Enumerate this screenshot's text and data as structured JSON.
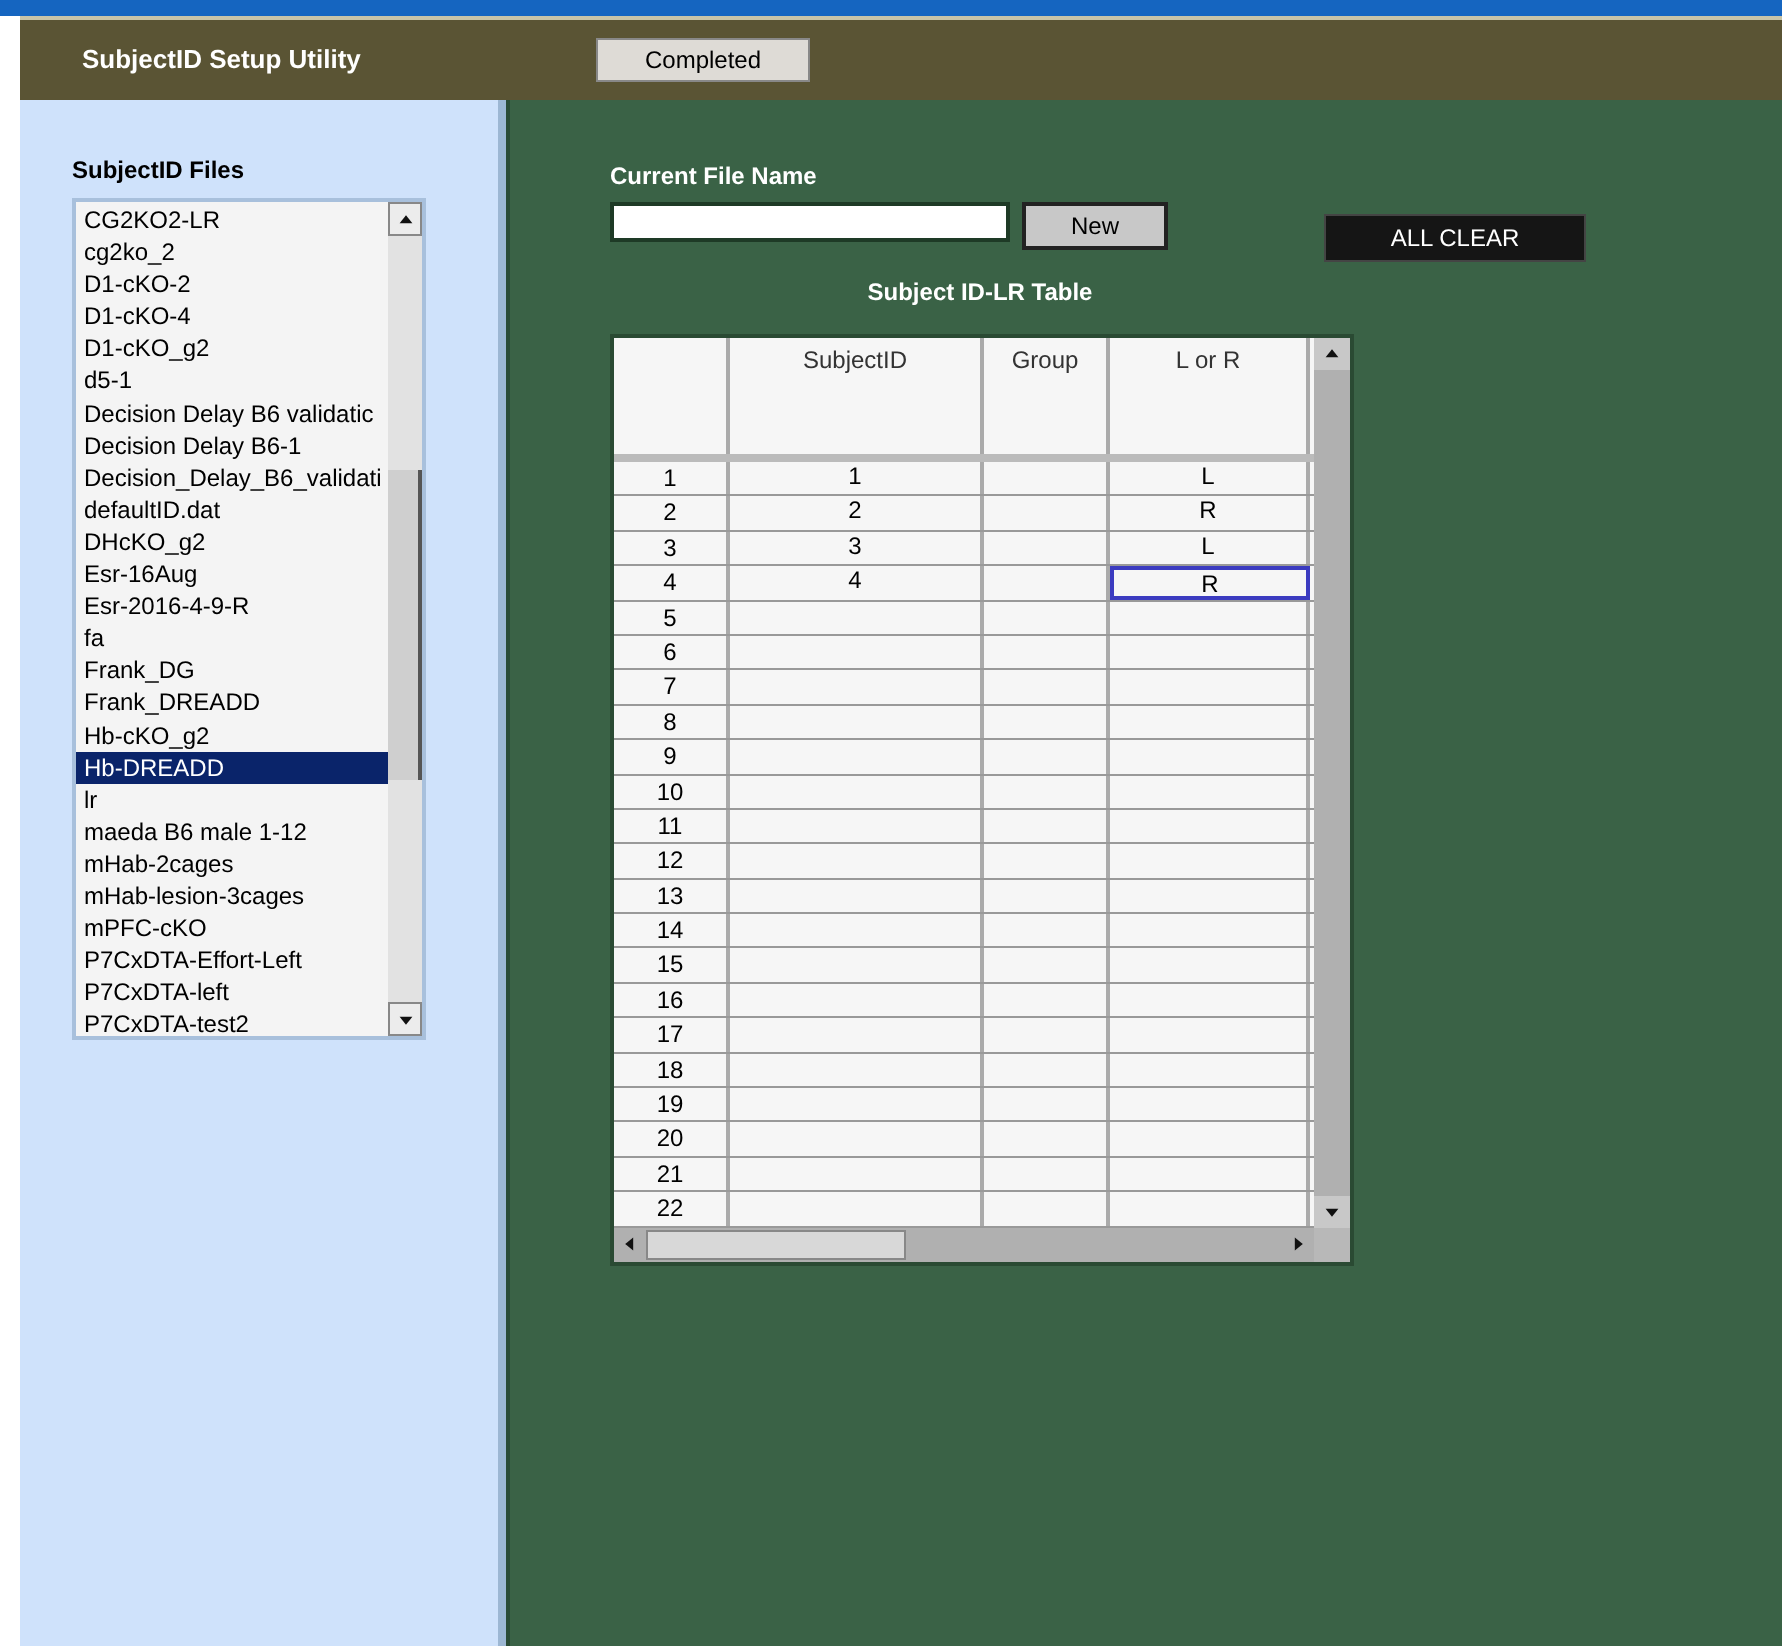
{
  "header": {
    "title": "SubjectID  Setup Utility",
    "button": "Completed"
  },
  "files": {
    "label": "SubjectID Files",
    "items": [
      {
        "name": "CG2KO2-LR",
        "selected": false
      },
      {
        "name": "cg2ko_2",
        "selected": false
      },
      {
        "name": "D1-cKO-2",
        "selected": false
      },
      {
        "name": "D1-cKO-4",
        "selected": false
      },
      {
        "name": "D1-cKO_g2",
        "selected": false
      },
      {
        "name": "d5-1",
        "selected": false
      },
      {
        "name": "Decision Delay B6 validatic",
        "selected": false
      },
      {
        "name": "Decision Delay B6-1",
        "selected": false
      },
      {
        "name": "Decision_Delay_B6_validati",
        "selected": false
      },
      {
        "name": "defaultID.dat",
        "selected": false
      },
      {
        "name": "DHcKO_g2",
        "selected": false
      },
      {
        "name": "Esr-16Aug",
        "selected": false
      },
      {
        "name": "Esr-2016-4-9-R",
        "selected": false
      },
      {
        "name": "fa",
        "selected": false
      },
      {
        "name": "Frank_DG",
        "selected": false
      },
      {
        "name": "Frank_DREADD",
        "selected": false
      },
      {
        "name": "Hb-cKO_g2",
        "selected": false
      },
      {
        "name": "Hb-DREADD",
        "selected": true
      },
      {
        "name": "lr",
        "selected": false
      },
      {
        "name": "maeda B6 male 1-12",
        "selected": false
      },
      {
        "name": "mHab-2cages",
        "selected": false
      },
      {
        "name": "mHab-lesion-3cages",
        "selected": false
      },
      {
        "name": "mPFC-cKO",
        "selected": false
      },
      {
        "name": "P7CxDTA-Effort-Left",
        "selected": false
      },
      {
        "name": "P7CxDTA-left",
        "selected": false
      },
      {
        "name": "P7CxDTA-test2",
        "selected": false
      }
    ]
  },
  "current_file": {
    "label": "Current File Name",
    "new_button": "New"
  },
  "all_clear_button": "ALL CLEAR",
  "table": {
    "title": "Subject ID-LR Table",
    "columns": [
      "SubjectID",
      "Group",
      "L or R"
    ],
    "rows": [
      {
        "index": "1",
        "cells": [
          {
            "text": "1",
            "selected": false
          },
          {
            "selected": false
          },
          {
            "text": "L",
            "selected": false
          }
        ]
      },
      {
        "index": "2",
        "cells": [
          {
            "text": "2",
            "selected": false
          },
          {
            "selected": false
          },
          {
            "text": "R",
            "selected": false
          }
        ]
      },
      {
        "index": "3",
        "cells": [
          {
            "text": "3",
            "selected": false
          },
          {
            "selected": false
          },
          {
            "text": "L",
            "selected": false
          }
        ]
      },
      {
        "index": "4",
        "cells": [
          {
            "text": "4",
            "selected": false
          },
          {
            "selected": false
          },
          {
            "text": "R",
            "selected": true
          }
        ]
      },
      {
        "index": "5",
        "cells": [
          {
            "selected": false
          },
          {
            "selected": false
          },
          {
            "selected": false
          }
        ]
      },
      {
        "index": "6",
        "cells": [
          {
            "selected": false
          },
          {
            "selected": false
          },
          {
            "selected": false
          }
        ]
      },
      {
        "index": "7",
        "cells": [
          {
            "selected": false
          },
          {
            "selected": false
          },
          {
            "selected": false
          }
        ]
      },
      {
        "index": "8",
        "cells": [
          {
            "selected": false
          },
          {
            "selected": false
          },
          {
            "selected": false
          }
        ]
      },
      {
        "index": "9",
        "cells": [
          {
            "selected": false
          },
          {
            "selected": false
          },
          {
            "selected": false
          }
        ]
      },
      {
        "index": "10",
        "cells": [
          {
            "selected": false
          },
          {
            "selected": false
          },
          {
            "selected": false
          }
        ]
      },
      {
        "index": "11",
        "cells": [
          {
            "selected": false
          },
          {
            "selected": false
          },
          {
            "selected": false
          }
        ]
      },
      {
        "index": "12",
        "cells": [
          {
            "selected": false
          },
          {
            "selected": false
          },
          {
            "selected": false
          }
        ]
      },
      {
        "index": "13",
        "cells": [
          {
            "selected": false
          },
          {
            "selected": false
          },
          {
            "selected": false
          }
        ]
      },
      {
        "index": "14",
        "cells": [
          {
            "selected": false
          },
          {
            "selected": false
          },
          {
            "selected": false
          }
        ]
      },
      {
        "index": "15",
        "cells": [
          {
            "selected": false
          },
          {
            "selected": false
          },
          {
            "selected": false
          }
        ]
      },
      {
        "index": "16",
        "cells": [
          {
            "selected": false
          },
          {
            "selected": false
          },
          {
            "selected": false
          }
        ]
      },
      {
        "index": "17",
        "cells": [
          {
            "selected": false
          },
          {
            "selected": false
          },
          {
            "selected": false
          }
        ]
      },
      {
        "index": "18",
        "cells": [
          {
            "selected": false
          },
          {
            "selected": false
          },
          {
            "selected": false
          }
        ]
      },
      {
        "index": "19",
        "cells": [
          {
            "selected": false
          },
          {
            "selected": false
          },
          {
            "selected": false
          }
        ]
      },
      {
        "index": "20",
        "cells": [
          {
            "selected": false
          },
          {
            "selected": false
          },
          {
            "selected": false
          }
        ]
      },
      {
        "index": "21",
        "cells": [
          {
            "selected": false
          },
          {
            "selected": false
          },
          {
            "selected": false
          }
        ]
      },
      {
        "index": "22",
        "cells": [
          {
            "selected": false
          },
          {
            "selected": false
          },
          {
            "selected": false
          }
        ]
      }
    ]
  }
}
